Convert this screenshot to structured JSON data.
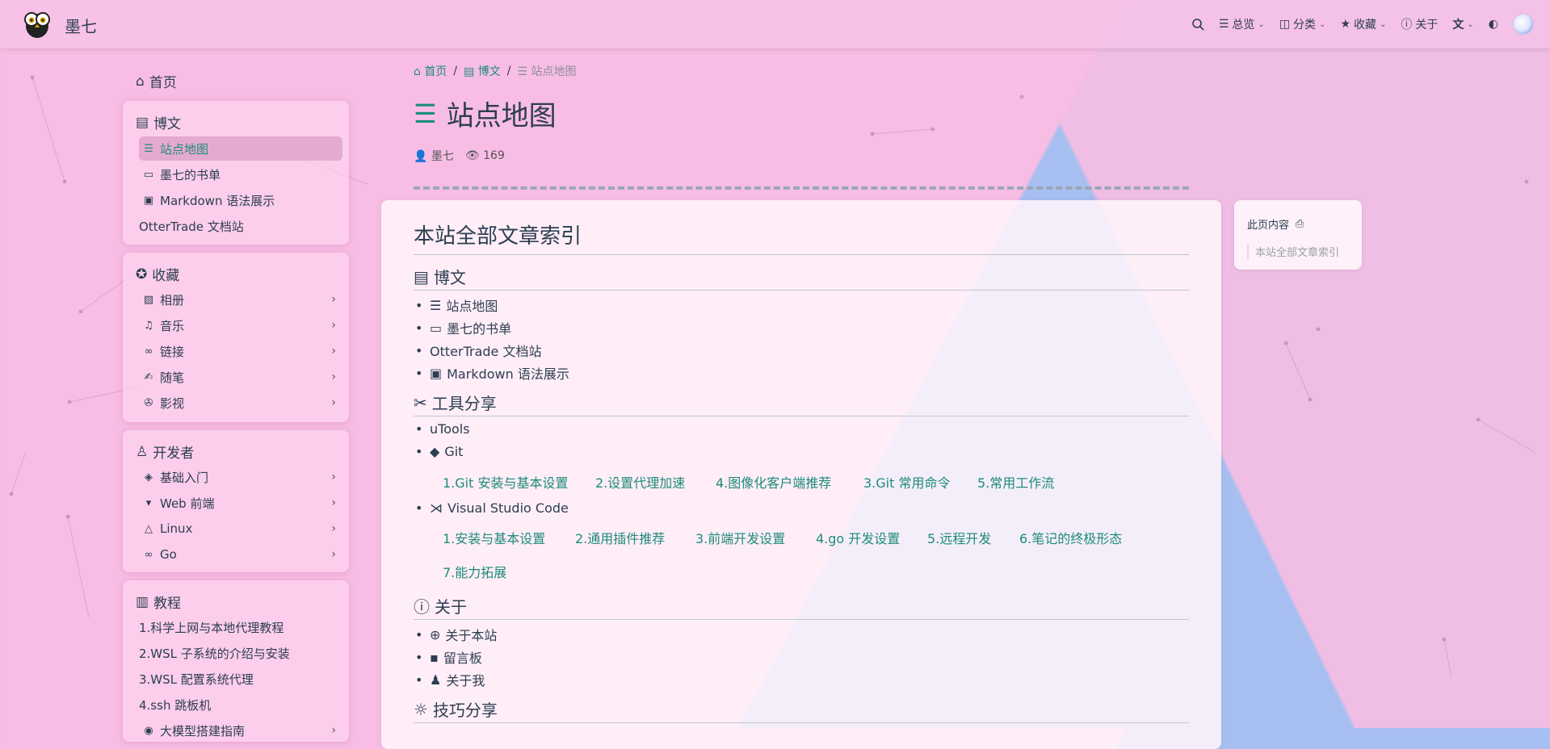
{
  "site": {
    "name": "墨七"
  },
  "nav": {
    "overview": "总览",
    "category": "分类",
    "favorites": "收藏",
    "about": "关于"
  },
  "sidebar": {
    "home": "首页",
    "blog": {
      "title": "博文",
      "items": [
        "站点地图",
        "墨七的书单",
        "Markdown 语法展示",
        "OtterTrade 文档站"
      ]
    },
    "collect": {
      "title": "收藏",
      "items": [
        "相册",
        "音乐",
        "链接",
        "随笔",
        "影视"
      ]
    },
    "dev": {
      "title": "开发者",
      "items": [
        "基础入门",
        "Web 前端",
        "Linux",
        "Go"
      ]
    },
    "tutorial": {
      "title": "教程",
      "items": [
        "1.科学上网与本地代理教程",
        "2.WSL 子系统的介绍与安装",
        "3.WSL 配置系统代理",
        "4.ssh 跳板机",
        "大模型搭建指南"
      ]
    }
  },
  "breadcrumb": {
    "home": "首页",
    "blog": "博文",
    "current": "站点地图"
  },
  "page": {
    "title": "站点地图",
    "author": "墨七",
    "views": "169"
  },
  "content": {
    "h1": "本站全部文章索引",
    "blog": {
      "title": "博文",
      "items": [
        "站点地图",
        "墨七的书单",
        "OtterTrade 文档站",
        "Markdown 语法展示"
      ]
    },
    "tools": {
      "title": "工具分享",
      "utools": "uTools",
      "git": "Git",
      "git_links": [
        "1.Git 安装与基本设置",
        "2.设置代理加速",
        "4.图像化客户端推荐",
        "3.Git 常用命令",
        "5.常用工作流"
      ],
      "vscode": "Visual Studio Code",
      "vscode_links": [
        "1.安装与基本设置",
        "2.通用插件推荐",
        "3.前端开发设置",
        "4.go 开发设置",
        "5.远程开发",
        "6.笔记的终极形态",
        "7.能力拓展"
      ]
    },
    "about": {
      "title": "关于",
      "items": [
        "关于本站",
        "留言板",
        "关于我"
      ]
    },
    "tips": {
      "title": "技巧分享"
    }
  },
  "toc": {
    "title": "此页内容",
    "item": "本站全部文章索引"
  },
  "colors": {
    "accent": "#1e8b7a",
    "pink": "#f8bde4",
    "blue": "#a7bff0"
  }
}
